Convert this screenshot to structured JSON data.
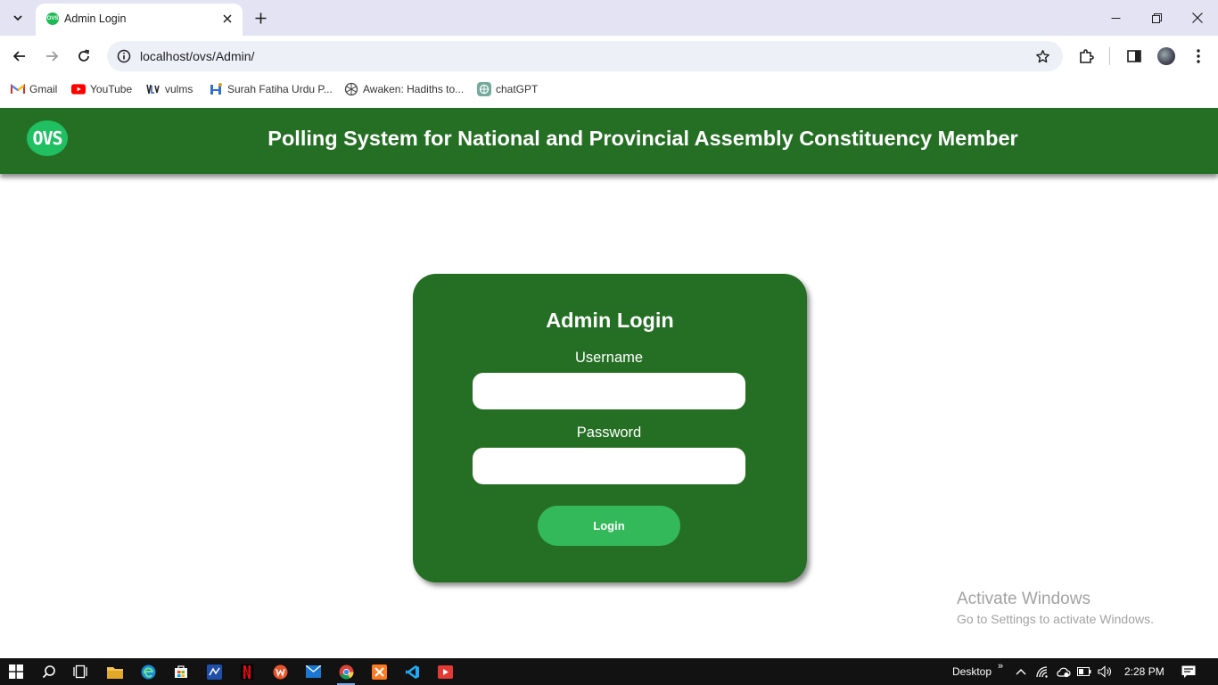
{
  "browser": {
    "tab_title": "Admin Login",
    "tab_favicon_text": "OVS",
    "url": "localhost/ovs/Admin/",
    "bookmarks": [
      {
        "label": "Gmail",
        "icon": "gmail-icon"
      },
      {
        "label": "YouTube",
        "icon": "youtube-icon"
      },
      {
        "label": "vulms",
        "icon": "vulms-icon"
      },
      {
        "label": "Surah Fatiha Urdu P...",
        "icon": "site-icon"
      },
      {
        "label": "Awaken: Hadiths to...",
        "icon": "openai-icon"
      },
      {
        "label": "chatGPT",
        "icon": "chatgpt-icon"
      }
    ]
  },
  "site": {
    "logo_text": "OVS",
    "title": "Polling System for National and Provincial Assembly Constituency Member"
  },
  "login": {
    "heading": "Admin Login",
    "username_label": "Username",
    "username_value": "",
    "password_label": "Password",
    "password_value": "",
    "button_label": "Login"
  },
  "watermark": {
    "title": "Activate Windows",
    "subtitle": "Go to Settings to activate Windows."
  },
  "taskbar": {
    "desktop_label": "Desktop",
    "chevrons": "»",
    "time": "2:28 PM"
  },
  "colors": {
    "brand_green": "#256f24",
    "button_green": "#33b95a",
    "logo_green": "#1fbf62"
  }
}
